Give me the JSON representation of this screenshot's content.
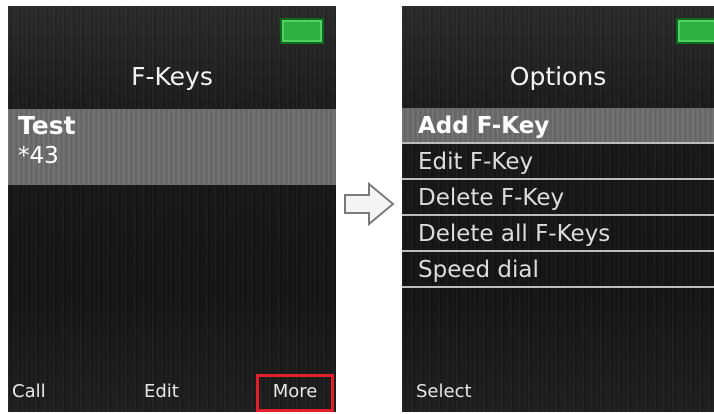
{
  "left_screen": {
    "title": "F-Keys",
    "fkey_item": {
      "name": "Test",
      "number": "*43"
    },
    "softkeys": {
      "left": "Call",
      "middle": "Edit",
      "right": "More"
    },
    "battery_color": "#2fb042",
    "highlight_color": "#e2202c"
  },
  "right_screen": {
    "title": "Options",
    "options": [
      "Add F-Key",
      "Edit F-Key",
      "Delete F-Key",
      "Delete all F-Keys",
      "Speed dial"
    ],
    "selected_index": 0,
    "softkeys": {
      "left": "Select"
    }
  },
  "transition_icon": "right-arrow-icon"
}
